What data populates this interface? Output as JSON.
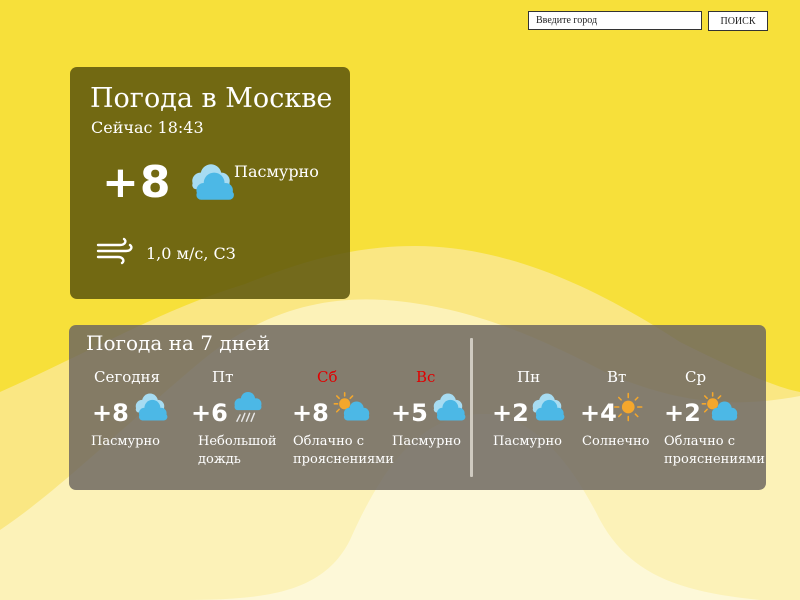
{
  "colors": {
    "background": "#f7e03a",
    "weekend_day": "#e00000",
    "cloud": "#4cb8e6",
    "sun": "#f4a72c"
  },
  "search": {
    "placeholder": "Введите город",
    "button_label": "ПОИСК"
  },
  "current": {
    "title": "Погода в Москве",
    "time": "Сейчас 18:43",
    "temperature": "+8",
    "icon": "cloudy-icon",
    "condition": "Пасмурно",
    "wind": "1,0 м/с, СЗ"
  },
  "forecast": {
    "title": "Погода на 7 дней",
    "days": [
      {
        "name": "Сегодня",
        "temp": "+8",
        "icon": "cloudy-icon",
        "condition_lines": [
          "Пасмурно"
        ],
        "weekend": false
      },
      {
        "name": "Пт",
        "temp": "+6",
        "icon": "rain-icon",
        "condition_lines": [
          "Небольшой",
          "дождь"
        ],
        "weekend": false
      },
      {
        "name": "Сб",
        "temp": "+8",
        "icon": "partly-cloudy-icon",
        "condition_lines": [
          "Облачно с",
          "прояснениями"
        ],
        "weekend": true
      },
      {
        "name": "Вс",
        "temp": "+5",
        "icon": "cloudy-icon",
        "condition_lines": [
          "Пасмурно"
        ],
        "weekend": true
      },
      {
        "name": "Пн",
        "temp": "+2",
        "icon": "cloudy-icon",
        "condition_lines": [
          "Пасмурно"
        ],
        "weekend": false
      },
      {
        "name": "Вт",
        "temp": "+4",
        "icon": "sunny-icon",
        "condition_lines": [
          "Солнечно"
        ],
        "weekend": false
      },
      {
        "name": "Ср",
        "temp": "+2",
        "icon": "partly-cloudy-icon",
        "condition_lines": [
          "Облачно с",
          "прояснениями"
        ],
        "weekend": false
      }
    ]
  }
}
